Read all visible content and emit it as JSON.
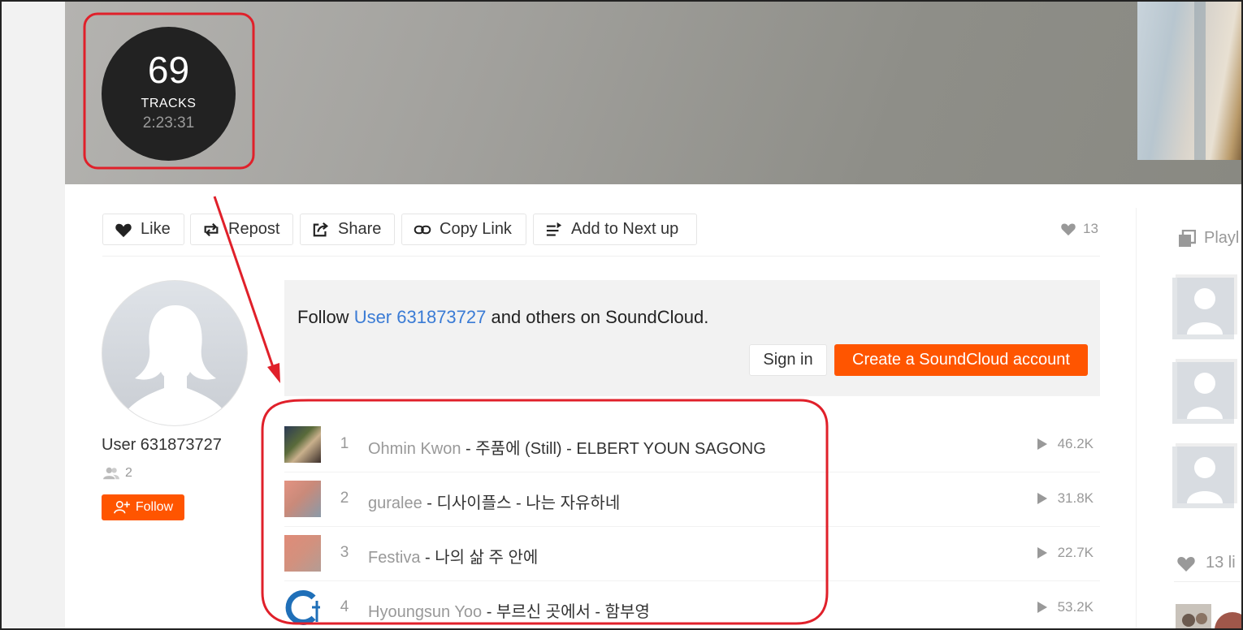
{
  "hero": {
    "track_count": "69",
    "tracks_label": "TRACKS",
    "duration": "2:23:31"
  },
  "toolbar": {
    "like_label": "Like",
    "repost_label": "Repost",
    "share_label": "Share",
    "copy_link_label": "Copy Link",
    "add_next_label": "Add to Next up",
    "likes_count": "13"
  },
  "profile": {
    "username": "User 631873727",
    "followers": "2",
    "follow_label": "Follow"
  },
  "promo": {
    "prefix": "Follow ",
    "user": "User 631873727",
    "suffix": " and others on SoundCloud.",
    "signin_label": "Sign in",
    "create_label": "Create a SoundCloud account"
  },
  "tracks": [
    {
      "index": "1",
      "artist": "Ohmin Kwon",
      "title": " - 주품에 (Still) - ELBERT YOUN SAGONG",
      "plays": "46.2K"
    },
    {
      "index": "2",
      "artist": "guralee",
      "title": " - 디사이플스 - 나는 자유하네",
      "plays": "31.8K"
    },
    {
      "index": "3",
      "artist": "Festiva",
      "title": " - 나의 삶 주 안에",
      "plays": "22.7K"
    },
    {
      "index": "4",
      "artist": "Hyoungsun Yoo",
      "title": " - 부르신 곳에서 - 함부영",
      "plays": "53.2K"
    }
  ],
  "sidebar": {
    "playlists_label": "Playl",
    "likes_label": "13 li"
  },
  "colors": {
    "accent": "#ff5500",
    "link": "#3a7bd5",
    "annotation": "#e0202a"
  },
  "icons": [
    "heart-icon",
    "repost-icon",
    "share-icon",
    "link-icon",
    "next-up-icon",
    "play-icon",
    "followers-icon",
    "follow-user-icon",
    "playlist-icon"
  ]
}
